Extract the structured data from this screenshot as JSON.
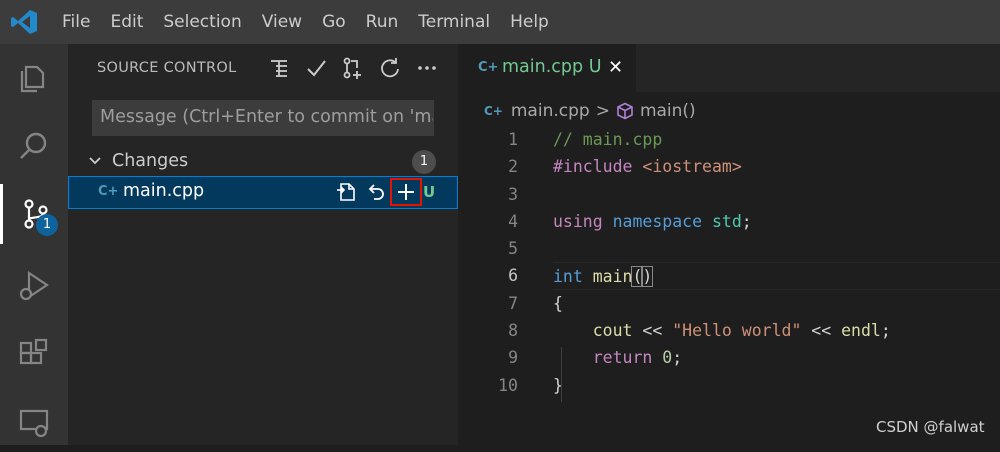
{
  "menu": [
    "File",
    "Edit",
    "Selection",
    "View",
    "Go",
    "Run",
    "Terminal",
    "Help"
  ],
  "activity_bar": {
    "items": [
      "explorer-icon",
      "search-icon",
      "source-control-icon",
      "run-debug-icon",
      "extensions-icon",
      "remote-explorer-icon"
    ],
    "source_control_badge": "1"
  },
  "sidebar": {
    "title": "SOURCE CONTROL",
    "actions": [
      "view-as-tree-icon",
      "commit-check-icon",
      "create-pull-request-icon",
      "refresh-icon",
      "more-actions-icon"
    ],
    "commit_placeholder": "Message (Ctrl+Enter to commit on 'ma...",
    "changes_label": "Changes",
    "changes_count": "1",
    "file": {
      "icon": "C+",
      "name": "main.cpp",
      "actions": [
        "open-file-icon",
        "discard-changes-icon",
        "stage-changes-icon"
      ],
      "status": "U"
    }
  },
  "editor": {
    "tab": {
      "icon": "C+",
      "label": "main.cpp U"
    },
    "breadcrumb": {
      "file": "main.cpp",
      "separator": ">",
      "symbol": "main()"
    },
    "line_numbers": [
      "1",
      "2",
      "3",
      "4",
      "5",
      "6",
      "7",
      "8",
      "9",
      "10"
    ],
    "current_line": "6",
    "code": {
      "l1": "// main.cpp",
      "l2_dir": "#include",
      "l2_hdr": " <iostream>",
      "l4_using": "using",
      "l4_ns": " namespace",
      "l4_std": " std",
      "l4_semi": ";",
      "l6_type": "int",
      "l6_name": " main",
      "l6_paren_open": "(",
      "l6_paren_close": ")",
      "l7": "{",
      "l8_cout": "    cout",
      "l8_op1": " << ",
      "l8_str": "\"Hello world\"",
      "l8_op2": " << ",
      "l8_endl": "endl",
      "l8_semi": ";",
      "l9_ret": "    return",
      "l9_num": " 0",
      "l9_semi": ";",
      "l10": "}"
    }
  },
  "watermark": "CSDN @falwat",
  "colors": {
    "accent": "#007fd4",
    "badge": "#0e639c",
    "highlight": "#e51400",
    "untracked": "#73c991"
  }
}
